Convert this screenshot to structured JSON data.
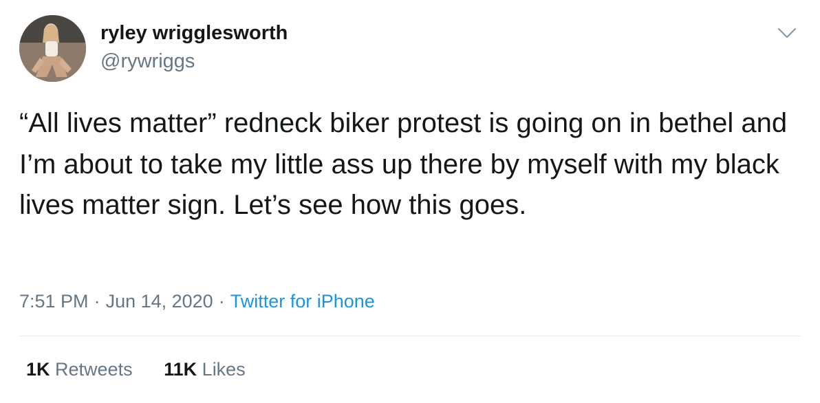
{
  "author": {
    "display_name": "ryley wrigglesworth",
    "handle": "@rywriggs"
  },
  "icons": {
    "avatar": "profile-photo",
    "menu": "chevron-down-icon"
  },
  "tweet": {
    "text": "“All lives matter” redneck biker protest is going on in bethel and I’m about to take my little ass up there by myself with my black lives matter sign. Let’s see how this goes.",
    "time": "7:51 PM",
    "date": "Jun 14, 2020",
    "separator": "·",
    "source": "Twitter for iPhone"
  },
  "stats": {
    "retweets_count": "1K",
    "retweets_label": "Retweets",
    "likes_count": "11K",
    "likes_label": "Likes"
  },
  "colors": {
    "text": "#14171a",
    "secondary": "#657786",
    "link": "#1b95e0",
    "divider": "#e1e8ed"
  }
}
